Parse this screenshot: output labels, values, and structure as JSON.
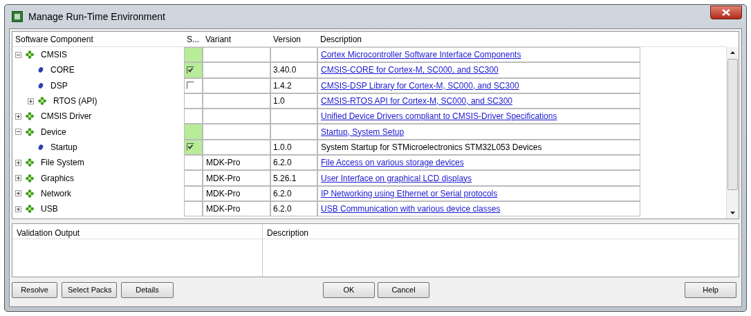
{
  "window": {
    "title": "Manage Run-Time Environment"
  },
  "table": {
    "columns": [
      "Software Component",
      "S...",
      "Variant",
      "Version",
      "Description"
    ],
    "rows": [
      {
        "name": "CMSIS",
        "kind": "group",
        "expanded": true,
        "resolved": true,
        "description": "Cortex Microcontroller Software Interface Components",
        "link": true,
        "children": [
          {
            "name": "CORE",
            "kind": "leaf",
            "resolved": true,
            "checked": true,
            "version": "3.40.0",
            "description": "CMSIS-CORE for Cortex-M, SC000, and SC300",
            "link": true
          },
          {
            "name": "DSP",
            "kind": "leaf",
            "resolved": false,
            "checked": false,
            "version": "1.4.2",
            "description": "CMSIS-DSP Library for Cortex-M, SC000, and SC300",
            "link": true
          },
          {
            "name": "RTOS (API)",
            "kind": "group",
            "expanded": false,
            "resolved": false,
            "version": "1.0",
            "description": "CMSIS-RTOS API for Cortex-M, SC000, and SC300",
            "link": true
          }
        ]
      },
      {
        "name": "CMSIS Driver",
        "kind": "group",
        "expanded": false,
        "resolved": false,
        "description": "Unified Device Drivers compliant to CMSIS-Driver Specifications",
        "link": true
      },
      {
        "name": "Device",
        "kind": "group",
        "expanded": true,
        "resolved": true,
        "description": "Startup, System Setup",
        "link": true,
        "children": [
          {
            "name": "Startup",
            "kind": "leaf",
            "resolved": true,
            "checked": true,
            "version": "1.0.0",
            "description": "System Startup for STMicroelectronics STM32L053 Devices",
            "link": false
          }
        ]
      },
      {
        "name": "File System",
        "kind": "group",
        "expanded": false,
        "resolved": false,
        "variant": "MDK-Pro",
        "version": "6.2.0",
        "description": "File Access on various storage devices",
        "link": true
      },
      {
        "name": "Graphics",
        "kind": "group",
        "expanded": false,
        "resolved": false,
        "variant": "MDK-Pro",
        "version": "5.26.1",
        "description": "User Interface on graphical LCD displays",
        "link": true
      },
      {
        "name": "Network",
        "kind": "group",
        "expanded": false,
        "resolved": false,
        "variant": "MDK-Pro",
        "version": "6.2.0",
        "description": "IP Networking using Ethernet or Serial protocols",
        "link": true
      },
      {
        "name": "USB",
        "kind": "group",
        "expanded": false,
        "resolved": false,
        "variant": "MDK-Pro",
        "version": "6.2.0",
        "description": "USB Communication with various device classes",
        "link": true
      }
    ]
  },
  "output": {
    "columns": [
      "Validation Output",
      "Description"
    ]
  },
  "buttons_left": [
    "Resolve",
    "Select Packs",
    "Details"
  ],
  "buttons_center": [
    "OK",
    "Cancel"
  ],
  "buttons_right": [
    "Help"
  ]
}
